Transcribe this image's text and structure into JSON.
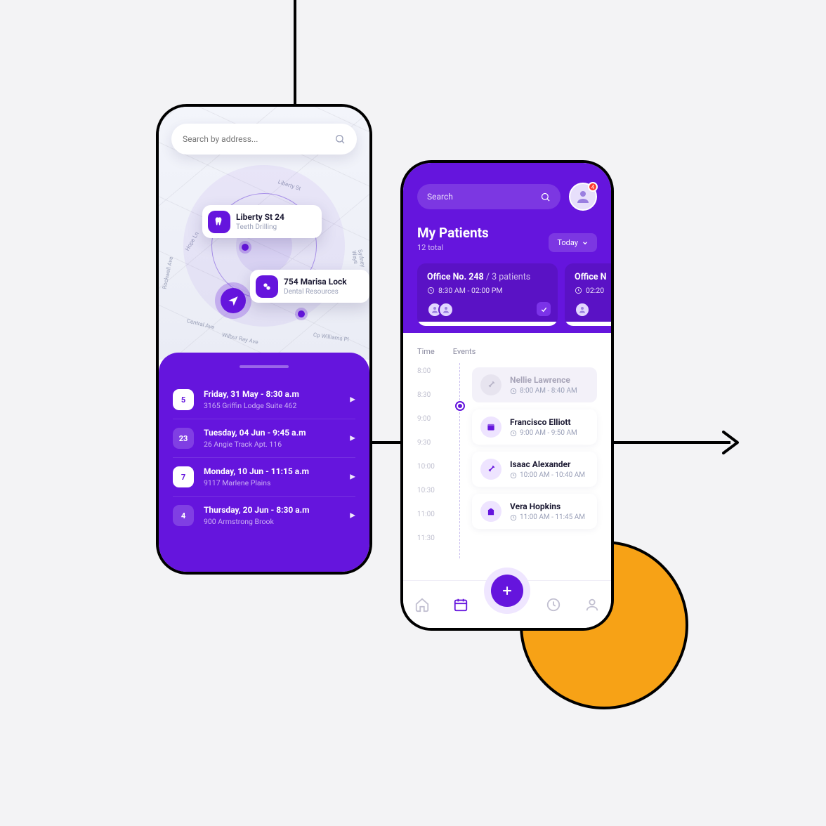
{
  "colors": {
    "primary": "#6515dd",
    "accent": "#f7a216"
  },
  "left": {
    "search_placeholder": "Search by address...",
    "pins": [
      {
        "title": "Liberty St 24",
        "sub": "Teeth Drilling"
      },
      {
        "title": "754 Marisa Lock",
        "sub": "Dental Resources"
      }
    ],
    "streets": [
      "Liberty St",
      "Hope Ln",
      "Central Ave",
      "Wilbur Ray Ave",
      "Cp Williams Pl",
      "Sydney Ways",
      "Rockwell Ave"
    ],
    "appointments": [
      {
        "day": "5",
        "style": "solid",
        "title": "Friday, 31 May - 8:30 a.m",
        "addr": "3165 Griffin Lodge Suite 462"
      },
      {
        "day": "23",
        "style": "ghost",
        "title": "Tuesday, 04 Jun - 9:45 a.m",
        "addr": "26 Angie Track Apt. 116"
      },
      {
        "day": "7",
        "style": "solid",
        "title": "Monday, 10 Jun - 11:15 a.m",
        "addr": "9117 Marlene Plains"
      },
      {
        "day": "4",
        "style": "ghost",
        "title": "Thursday, 20 Jun - 8:30 a.m",
        "addr": "900 Armstrong Brook"
      }
    ]
  },
  "right": {
    "search_placeholder": "Search",
    "notif_count": "4",
    "page_title": "My Patients",
    "page_sub": "12 total",
    "filter_label": "Today",
    "offices": [
      {
        "name": "Office No. 248",
        "patients": "3 patients",
        "hours": "8:30 AM - 02:00 PM",
        "checked": true
      },
      {
        "name": "Office N",
        "patients": "",
        "hours": "02:20",
        "checked": false
      }
    ],
    "headers": {
      "time": "Time",
      "events": "Events"
    },
    "hours": [
      "8:00",
      "8:30",
      "9:00",
      "9:30",
      "10:00",
      "10:30",
      "11:00",
      "11:30"
    ],
    "events": [
      {
        "name": "Nellie Lawrence",
        "time": "8:00 AM - 8:40 AM",
        "state": "past"
      },
      {
        "name": "Francisco Elliott",
        "time": "9:00 AM - 9:50 AM",
        "state": "active"
      },
      {
        "name": "Isaac Alexander",
        "time": "10:00 AM - 10:40 AM",
        "state": "active"
      },
      {
        "name": "Vera Hopkins",
        "time": "11:00 AM - 11:45 AM",
        "state": "active"
      }
    ]
  }
}
